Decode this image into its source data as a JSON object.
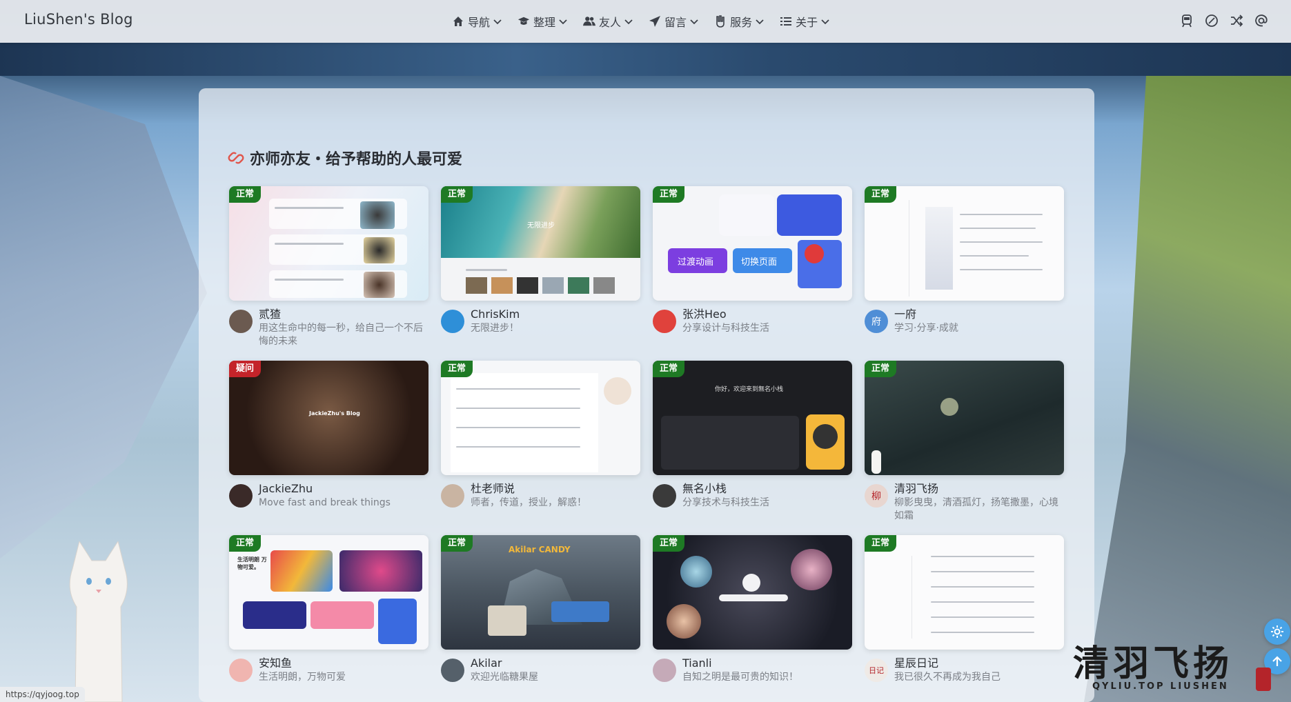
{
  "navbar": {
    "brand": "LiuShen's Blog",
    "menu": [
      {
        "label": "导航",
        "icon": "home-icon"
      },
      {
        "label": "整理",
        "icon": "graduation-cap-icon"
      },
      {
        "label": "友人",
        "icon": "users-icon"
      },
      {
        "label": "留言",
        "icon": "paper-plane-icon"
      },
      {
        "label": "服务",
        "icon": "hand-icon"
      },
      {
        "label": "关于",
        "icon": "list-icon"
      }
    ],
    "tools": [
      "train-icon",
      "link-icon",
      "shuffle-icon",
      "at-icon"
    ]
  },
  "section": {
    "title": "亦师亦友・给予帮助的人最可爱"
  },
  "friends": [
    {
      "status": "正常",
      "name": "贰猹",
      "desc": "用这生命中的每一秒，给自己一个不后悔的未来",
      "avatar_color": "#6b5a50"
    },
    {
      "status": "正常",
      "name": "ChrisKim",
      "desc": "无限进步！",
      "avatar_color": "#2e8fd8"
    },
    {
      "status": "正常",
      "name": "张洪Heo",
      "desc": "分享设计与科技生活",
      "avatar_color": "#e0423c"
    },
    {
      "status": "正常",
      "name": "一府",
      "desc": "学习·分享·成就",
      "avatar_color": "#4f8ed6",
      "avatar_text": "府"
    },
    {
      "status": "疑问",
      "name": "JackieZhu",
      "desc": "Move fast and break things",
      "avatar_color": "#3a2a28"
    },
    {
      "status": "正常",
      "name": "杜老师说",
      "desc": "师者，传道，授业，解惑！",
      "avatar_color": "#c9b4a2"
    },
    {
      "status": "正常",
      "name": "無名小栈",
      "desc": "分享技术与科技生活",
      "avatar_color": "#3a3a3a"
    },
    {
      "status": "正常",
      "name": "清羽飞扬",
      "desc": "柳影曳曳，清酒孤灯，扬笔撒墨，心境如霜",
      "avatar_color": "#e8d6d0",
      "avatar_text": "柳"
    },
    {
      "status": "正常",
      "name": "安知鱼",
      "desc": "生活明朗，万物可爱",
      "avatar_color": "#f0b5b0"
    },
    {
      "status": "正常",
      "name": "Akilar",
      "desc": "欢迎光临糖果屋",
      "avatar_color": "#55606a"
    },
    {
      "status": "正常",
      "name": "Tianli",
      "desc": "自知之明是最可贵的知识！",
      "avatar_color": "#c5aab8"
    },
    {
      "status": "正常",
      "name": "星辰日记",
      "desc": "我已很久不再成为我自己",
      "avatar_color": "#efeae6",
      "avatar_text": "日记"
    }
  ],
  "thumb_texts": {
    "chriskim": "无限进步",
    "heo_left": "过渡动画",
    "heo_right": "切换页面",
    "jackie": "JackieZhu's Blog",
    "wuming": "你好，欢迎来到無名小栈",
    "anzhiyu": "生活明朗 万物可爱。",
    "akilar": "Akilar CANDY"
  },
  "watermark": {
    "title": "清羽飞扬",
    "sub": "QYLIU.TOP  LIUSHEN"
  },
  "status_url": "https://qyjoog.top"
}
